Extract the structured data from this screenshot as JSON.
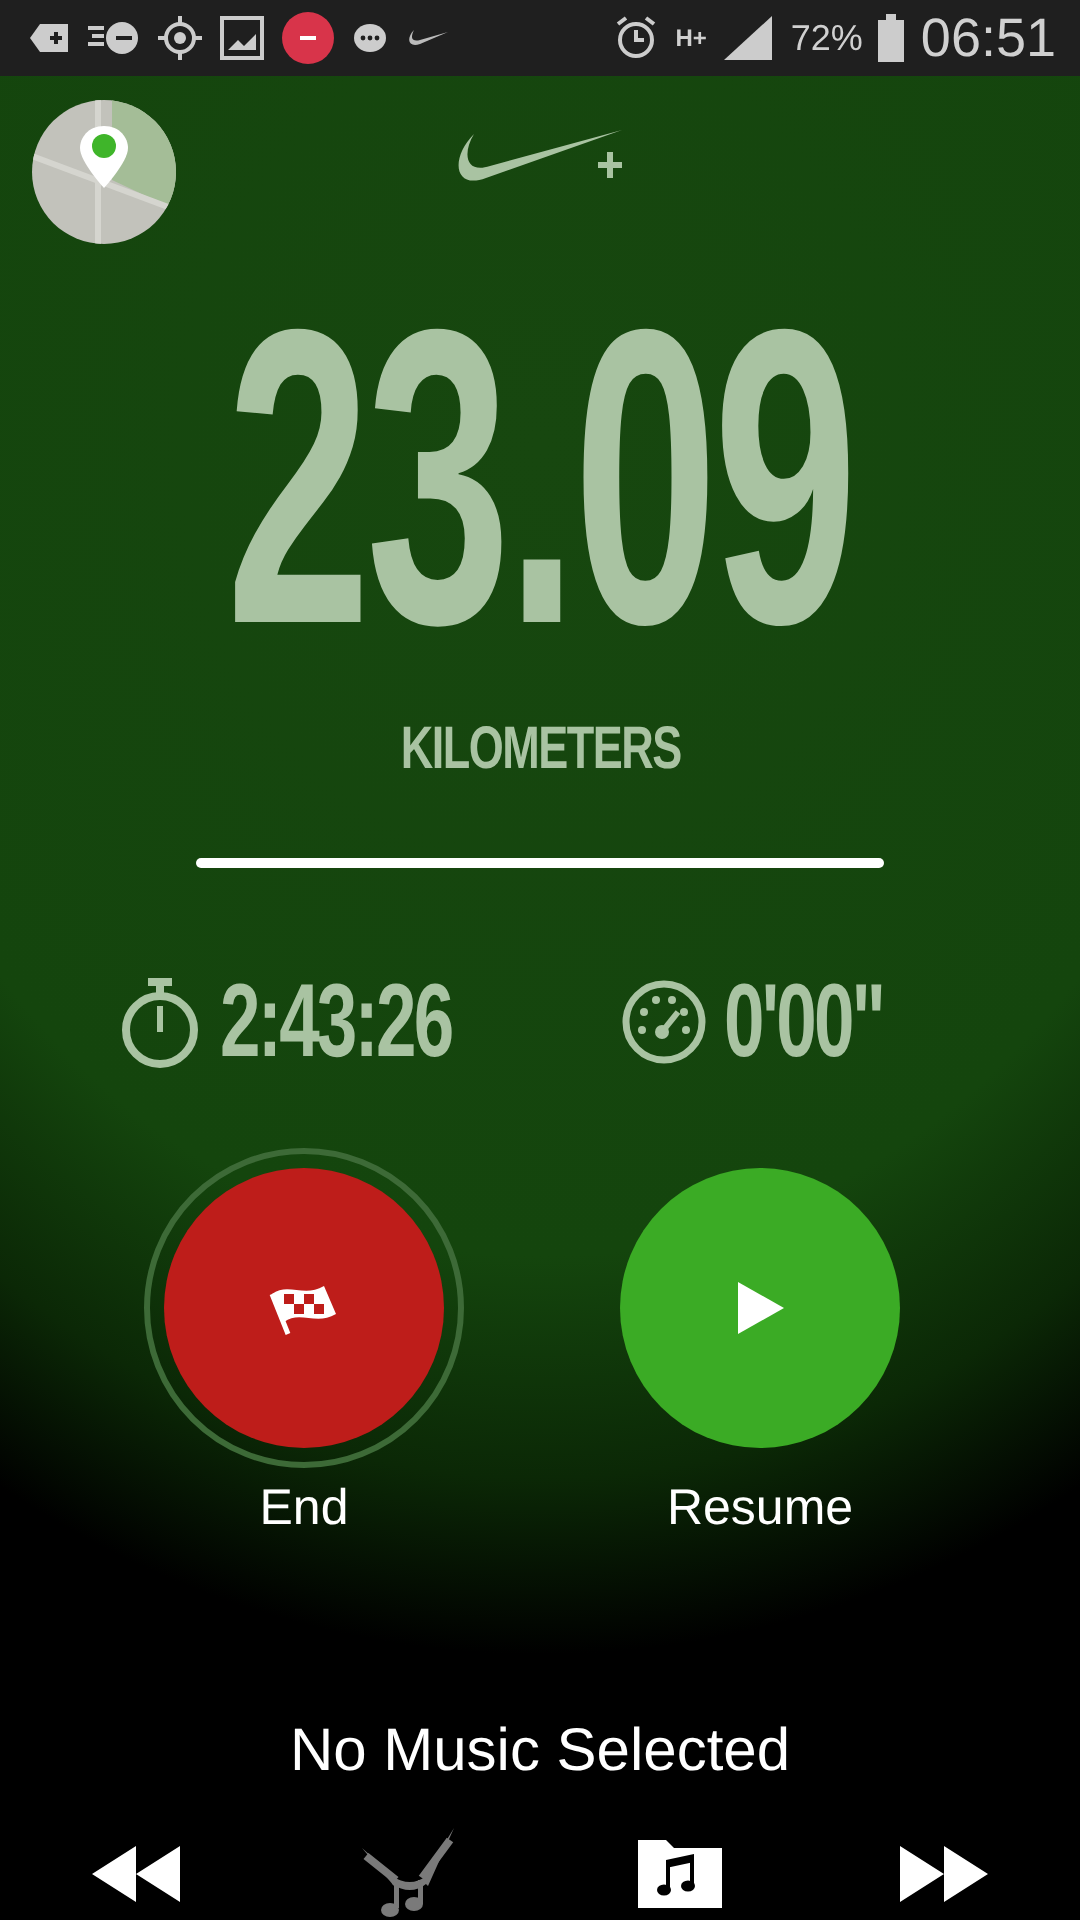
{
  "status_bar": {
    "network": "H+",
    "battery": "72%",
    "time": "06:51"
  },
  "distance": {
    "value": "23.09",
    "unit": "KILOMETERS"
  },
  "stats": [
    {
      "kind": "duration",
      "value": "2:43:26"
    },
    {
      "kind": "pace",
      "value": "0'00\""
    }
  ],
  "actions": [
    {
      "kind": "end",
      "label": "End"
    },
    {
      "kind": "resume",
      "label": "Resume"
    }
  ],
  "music": {
    "title": "No Music Selected"
  }
}
